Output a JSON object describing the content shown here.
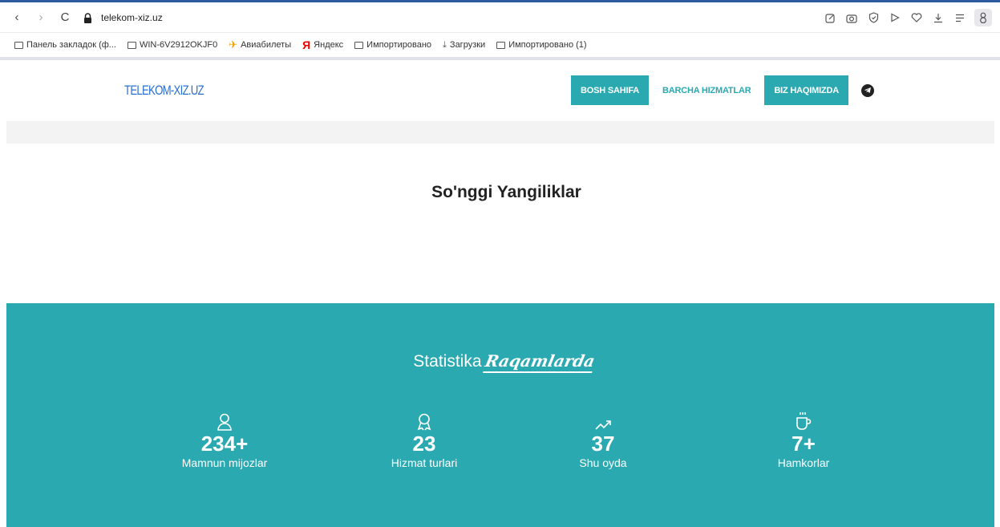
{
  "browser": {
    "url": "telekom-xiz.uz",
    "nav": {
      "back": "‹",
      "forward": "›",
      "reload": "C"
    },
    "right_icons": [
      "edit-icon",
      "camera-icon",
      "shield-icon",
      "play-icon",
      "heart-icon",
      "download-icon",
      "menu-icon",
      "profile-icon"
    ],
    "bookmarks": [
      {
        "label": "Панель закладок (ф...",
        "icon": "folder-icon"
      },
      {
        "label": "WIN-6V2912OKJF0",
        "icon": "folder-icon"
      },
      {
        "label": "Авиабилеты",
        "icon": "plane-icon"
      },
      {
        "label": "Яндекс",
        "icon": "yandex-icon"
      },
      {
        "label": "Импортировано",
        "icon": "folder-icon"
      },
      {
        "label": "Загрузки",
        "icon": "download-icon"
      },
      {
        "label": "Импортировано (1)",
        "icon": "folder-icon"
      }
    ]
  },
  "site": {
    "logo": "TELEKOM-XIZ.UZ",
    "nav": [
      {
        "label": "BOSH SAHIFA",
        "active": true
      },
      {
        "label": "BARCHA HIZMATLAR",
        "active": false
      },
      {
        "label": "BIZ HAQIMIZDA",
        "active": true
      }
    ],
    "telegram_icon": "telegram-icon"
  },
  "news": {
    "title_light": "So'nggi ",
    "title_bold": "Yangiliklar"
  },
  "stats": {
    "title_light": "Statistika",
    "title_script": "Raqamlarda",
    "items": [
      {
        "icon": "user-icon",
        "number": "234+",
        "label": "Mamnun mijozlar"
      },
      {
        "icon": "award-icon",
        "number": "23",
        "label": "Hizmat turlari"
      },
      {
        "icon": "trending-icon",
        "number": "37",
        "label": "Shu oyda"
      },
      {
        "icon": "coffee-icon",
        "number": "7+",
        "label": "Hamkorlar"
      }
    ]
  },
  "colors": {
    "accent": "#2ba9b1",
    "logo": "#2a6fd0",
    "browser_top": "#2c5aa0"
  }
}
